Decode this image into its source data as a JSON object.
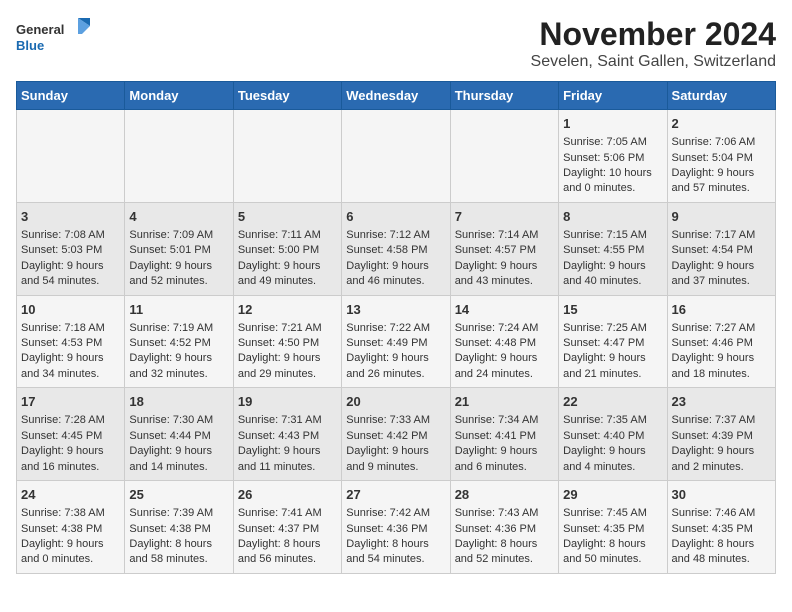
{
  "logo": {
    "line1": "General",
    "line2": "Blue"
  },
  "title": "November 2024",
  "subtitle": "Sevelen, Saint Gallen, Switzerland",
  "days_of_week": [
    "Sunday",
    "Monday",
    "Tuesday",
    "Wednesday",
    "Thursday",
    "Friday",
    "Saturday"
  ],
  "weeks": [
    [
      {
        "day": "",
        "content": ""
      },
      {
        "day": "",
        "content": ""
      },
      {
        "day": "",
        "content": ""
      },
      {
        "day": "",
        "content": ""
      },
      {
        "day": "",
        "content": ""
      },
      {
        "day": "1",
        "content": "Sunrise: 7:05 AM\nSunset: 5:06 PM\nDaylight: 10 hours and 0 minutes."
      },
      {
        "day": "2",
        "content": "Sunrise: 7:06 AM\nSunset: 5:04 PM\nDaylight: 9 hours and 57 minutes."
      }
    ],
    [
      {
        "day": "3",
        "content": "Sunrise: 7:08 AM\nSunset: 5:03 PM\nDaylight: 9 hours and 54 minutes."
      },
      {
        "day": "4",
        "content": "Sunrise: 7:09 AM\nSunset: 5:01 PM\nDaylight: 9 hours and 52 minutes."
      },
      {
        "day": "5",
        "content": "Sunrise: 7:11 AM\nSunset: 5:00 PM\nDaylight: 9 hours and 49 minutes."
      },
      {
        "day": "6",
        "content": "Sunrise: 7:12 AM\nSunset: 4:58 PM\nDaylight: 9 hours and 46 minutes."
      },
      {
        "day": "7",
        "content": "Sunrise: 7:14 AM\nSunset: 4:57 PM\nDaylight: 9 hours and 43 minutes."
      },
      {
        "day": "8",
        "content": "Sunrise: 7:15 AM\nSunset: 4:55 PM\nDaylight: 9 hours and 40 minutes."
      },
      {
        "day": "9",
        "content": "Sunrise: 7:17 AM\nSunset: 4:54 PM\nDaylight: 9 hours and 37 minutes."
      }
    ],
    [
      {
        "day": "10",
        "content": "Sunrise: 7:18 AM\nSunset: 4:53 PM\nDaylight: 9 hours and 34 minutes."
      },
      {
        "day": "11",
        "content": "Sunrise: 7:19 AM\nSunset: 4:52 PM\nDaylight: 9 hours and 32 minutes."
      },
      {
        "day": "12",
        "content": "Sunrise: 7:21 AM\nSunset: 4:50 PM\nDaylight: 9 hours and 29 minutes."
      },
      {
        "day": "13",
        "content": "Sunrise: 7:22 AM\nSunset: 4:49 PM\nDaylight: 9 hours and 26 minutes."
      },
      {
        "day": "14",
        "content": "Sunrise: 7:24 AM\nSunset: 4:48 PM\nDaylight: 9 hours and 24 minutes."
      },
      {
        "day": "15",
        "content": "Sunrise: 7:25 AM\nSunset: 4:47 PM\nDaylight: 9 hours and 21 minutes."
      },
      {
        "day": "16",
        "content": "Sunrise: 7:27 AM\nSunset: 4:46 PM\nDaylight: 9 hours and 18 minutes."
      }
    ],
    [
      {
        "day": "17",
        "content": "Sunrise: 7:28 AM\nSunset: 4:45 PM\nDaylight: 9 hours and 16 minutes."
      },
      {
        "day": "18",
        "content": "Sunrise: 7:30 AM\nSunset: 4:44 PM\nDaylight: 9 hours and 14 minutes."
      },
      {
        "day": "19",
        "content": "Sunrise: 7:31 AM\nSunset: 4:43 PM\nDaylight: 9 hours and 11 minutes."
      },
      {
        "day": "20",
        "content": "Sunrise: 7:33 AM\nSunset: 4:42 PM\nDaylight: 9 hours and 9 minutes."
      },
      {
        "day": "21",
        "content": "Sunrise: 7:34 AM\nSunset: 4:41 PM\nDaylight: 9 hours and 6 minutes."
      },
      {
        "day": "22",
        "content": "Sunrise: 7:35 AM\nSunset: 4:40 PM\nDaylight: 9 hours and 4 minutes."
      },
      {
        "day": "23",
        "content": "Sunrise: 7:37 AM\nSunset: 4:39 PM\nDaylight: 9 hours and 2 minutes."
      }
    ],
    [
      {
        "day": "24",
        "content": "Sunrise: 7:38 AM\nSunset: 4:38 PM\nDaylight: 9 hours and 0 minutes."
      },
      {
        "day": "25",
        "content": "Sunrise: 7:39 AM\nSunset: 4:38 PM\nDaylight: 8 hours and 58 minutes."
      },
      {
        "day": "26",
        "content": "Sunrise: 7:41 AM\nSunset: 4:37 PM\nDaylight: 8 hours and 56 minutes."
      },
      {
        "day": "27",
        "content": "Sunrise: 7:42 AM\nSunset: 4:36 PM\nDaylight: 8 hours and 54 minutes."
      },
      {
        "day": "28",
        "content": "Sunrise: 7:43 AM\nSunset: 4:36 PM\nDaylight: 8 hours and 52 minutes."
      },
      {
        "day": "29",
        "content": "Sunrise: 7:45 AM\nSunset: 4:35 PM\nDaylight: 8 hours and 50 minutes."
      },
      {
        "day": "30",
        "content": "Sunrise: 7:46 AM\nSunset: 4:35 PM\nDaylight: 8 hours and 48 minutes."
      }
    ]
  ]
}
